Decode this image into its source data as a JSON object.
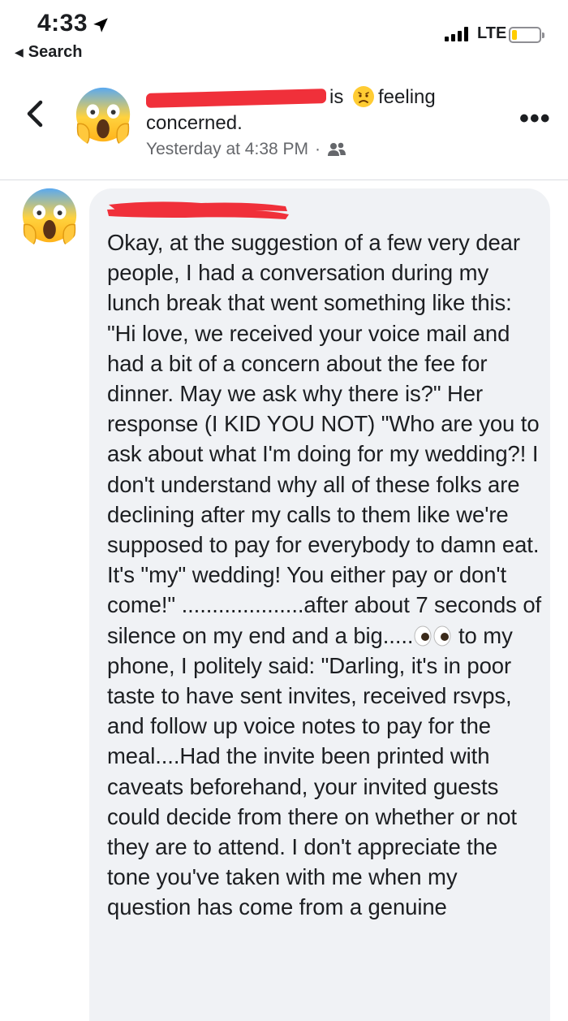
{
  "status_bar": {
    "time": "4:33",
    "back_app_label": "Search",
    "network": "LTE",
    "battery_level": 0.2
  },
  "post": {
    "verb_is": "is",
    "feeling_label": "feeling",
    "feeling_word": "concerned.",
    "timestamp": "Yesterday at 4:38 PM",
    "separator": "·",
    "audience_icon": "friends-icon",
    "author_avatar_icon": "screaming-face-emoji-icon",
    "feeling_icon": "worried-face-emoji-icon"
  },
  "comment": {
    "avatar_icon": "screaming-face-emoji-icon",
    "text_part1": "Okay, at the suggestion of a few very dear people, I had a conversation during my lunch break that went something like this: \"Hi love, we received your voice mail and had a bit of a concern about the fee for dinner. May we ask why there is?\" Her response (I KID YOU NOT) \"Who are you to ask about what I'm doing for my wedding?! I don't understand why all of these folks are declining after my calls to them like we're supposed to pay for everybody to damn eat. It's \"my\" wedding! You either pay or don't come!\" ....................after about 7 seconds of silence on my end and a big.....",
    "inline_icon": "eyes-emoji-icon",
    "text_part2": " to my phone, I politely said: \"Darling, it's in poor taste to have sent invites, received rsvps, and follow up voice notes to pay for the meal....Had the invite been printed with caveats beforehand, your invited guests could decide from there on whether or not they are to attend. I don't appreciate the tone you've taken with me when my question has come from a genuine"
  },
  "colors": {
    "redaction": "#f0303a",
    "bubble_bg": "#f0f2f5",
    "meta_text": "#65676b",
    "battery": "#ffcc00"
  }
}
